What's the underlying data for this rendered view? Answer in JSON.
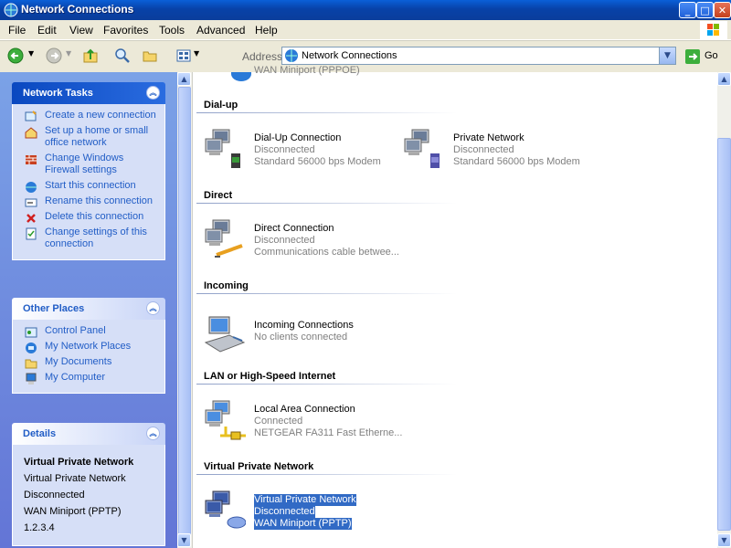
{
  "window": {
    "title": "Network Connections"
  },
  "menu": [
    "File",
    "Edit",
    "View",
    "Favorites",
    "Tools",
    "Advanced",
    "Help"
  ],
  "address": {
    "label": "Address",
    "value": "Network Connections",
    "go_label": "Go"
  },
  "left": {
    "network_tasks": {
      "title": "Network Tasks",
      "items": [
        "Create a new connection",
        "Set up a home or small office network",
        "Change Windows Firewall settings",
        "Start this connection",
        "Rename this connection",
        "Delete this connection",
        "Change settings of this connection"
      ]
    },
    "other_places": {
      "title": "Other Places",
      "items": [
        "Control Panel",
        "My Network Places",
        "My Documents",
        "My Computer"
      ]
    },
    "details": {
      "title": "Details",
      "name": "Virtual Private Network",
      "lines": [
        "Virtual Private Network",
        "Disconnected",
        "WAN Miniport (PPTP)",
        "1.2.3.4"
      ]
    }
  },
  "content": {
    "top_partial": "WAN Miniport (PPPOE)",
    "groups": [
      {
        "title": "Dial-up",
        "items": [
          {
            "name": "Dial-Up Connection",
            "status": "Disconnected",
            "device": "Standard 56000 bps Modem"
          },
          {
            "name": "Private Network",
            "status": "Disconnected",
            "device": "Standard 56000 bps Modem"
          }
        ]
      },
      {
        "title": "Direct",
        "items": [
          {
            "name": "Direct Connection",
            "status": "Disconnected",
            "device": "Communications cable betwee..."
          }
        ]
      },
      {
        "title": "Incoming",
        "items": [
          {
            "name": "Incoming Connections",
            "status": "No clients connected",
            "device": ""
          }
        ]
      },
      {
        "title": "LAN or High-Speed Internet",
        "items": [
          {
            "name": "Local Area Connection",
            "status": "Connected",
            "device": "NETGEAR FA311 Fast Etherne..."
          }
        ]
      },
      {
        "title": "Virtual Private Network",
        "items": [
          {
            "name": "Virtual Private Network",
            "status": "Disconnected",
            "device": "WAN Miniport (PPTP)"
          }
        ]
      }
    ]
  }
}
